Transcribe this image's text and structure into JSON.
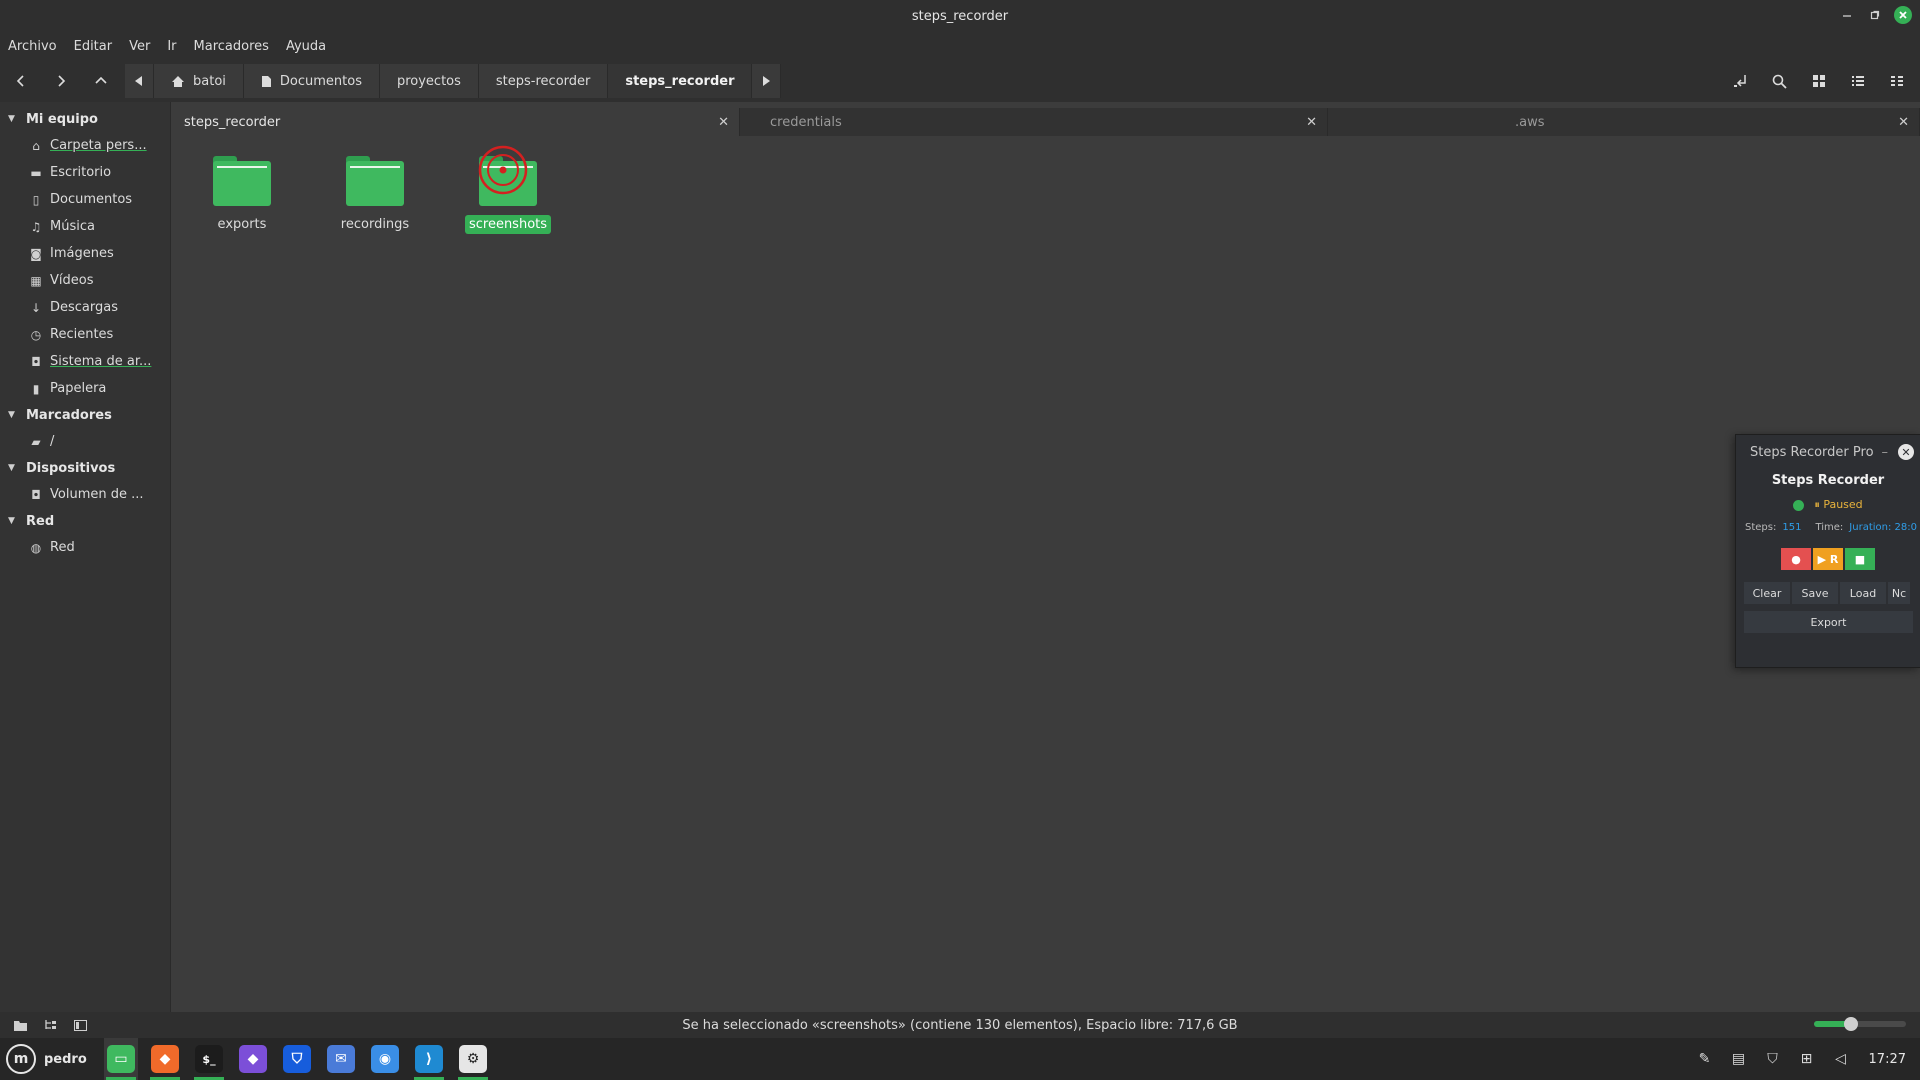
{
  "window": {
    "title": "steps_recorder"
  },
  "menubar": {
    "items": [
      "Archivo",
      "Editar",
      "Ver",
      "Ir",
      "Marcadores",
      "Ayuda"
    ]
  },
  "breadcrumb": {
    "items": [
      "batoi",
      "Documentos",
      "proyectos",
      "steps-recorder",
      "steps_recorder"
    ],
    "active_index": 4
  },
  "sidebar": {
    "sections": [
      {
        "title": "Mi equipo",
        "items": [
          {
            "label": "Carpeta pers...",
            "icon": "home-icon"
          },
          {
            "label": "Escritorio",
            "icon": "desktop-icon"
          },
          {
            "label": "Documentos",
            "icon": "document-icon"
          },
          {
            "label": "Música",
            "icon": "music-icon"
          },
          {
            "label": "Imágenes",
            "icon": "camera-icon"
          },
          {
            "label": "Vídeos",
            "icon": "film-icon"
          },
          {
            "label": "Descargas",
            "icon": "download-icon"
          },
          {
            "label": "Recientes",
            "icon": "clock-icon"
          },
          {
            "label": "Sistema de ar...",
            "icon": "drive-icon"
          },
          {
            "label": "Papelera",
            "icon": "trash-icon"
          }
        ]
      },
      {
        "title": "Marcadores",
        "items": [
          {
            "label": "/",
            "icon": "bookmark-folder-icon"
          }
        ]
      },
      {
        "title": "Dispositivos",
        "items": [
          {
            "label": "Volumen de ...",
            "icon": "volume-icon"
          }
        ]
      },
      {
        "title": "Red",
        "items": [
          {
            "label": "Red",
            "icon": "network-icon"
          }
        ]
      }
    ]
  },
  "tabs": [
    {
      "label": "steps_recorder",
      "active": true
    },
    {
      "label": "credentials",
      "active": false
    },
    {
      "label": ".aws",
      "active": false
    }
  ],
  "files": [
    {
      "name": "exports",
      "selected": false
    },
    {
      "name": "recordings",
      "selected": false
    },
    {
      "name": "screenshots",
      "selected": true
    }
  ],
  "statusbar": {
    "text": "Se ha seleccionado «screenshots» (contiene 130 elementos), Espacio libre: 717,6 GB",
    "zoom_level": 0.4
  },
  "taskbar": {
    "user": "pedro",
    "clock": "17:27",
    "apps": [
      {
        "name": "files-app",
        "running": true,
        "active": true
      },
      {
        "name": "brave-browser",
        "running": true
      },
      {
        "name": "terminal",
        "running": true
      },
      {
        "name": "obsidian",
        "running": false
      },
      {
        "name": "bitwarden",
        "running": false
      },
      {
        "name": "mail",
        "running": false
      },
      {
        "name": "screenshot-tool",
        "running": false
      },
      {
        "name": "vscode",
        "running": true
      },
      {
        "name": "settings",
        "running": true
      }
    ]
  },
  "recorder": {
    "window_title": "Steps Recorder Pro",
    "heading": "Steps Recorder",
    "status": "⏸ Paused",
    "steps_label": "Steps:",
    "steps_value": "151",
    "time_label": "Time:",
    "time_value": "Juration: 28:0",
    "buttons": {
      "record": "●",
      "resume": "▶ R",
      "stop": "■"
    },
    "actions": [
      "Clear",
      "Save",
      "Load",
      "Nc"
    ],
    "export_label": "Export"
  },
  "colors": {
    "accent": "#35b056",
    "window_bg": "#3c3c3c",
    "sidebar_bg": "#333333",
    "chrome_bg": "#2f2f2f",
    "taskbar_bg": "#262626"
  }
}
